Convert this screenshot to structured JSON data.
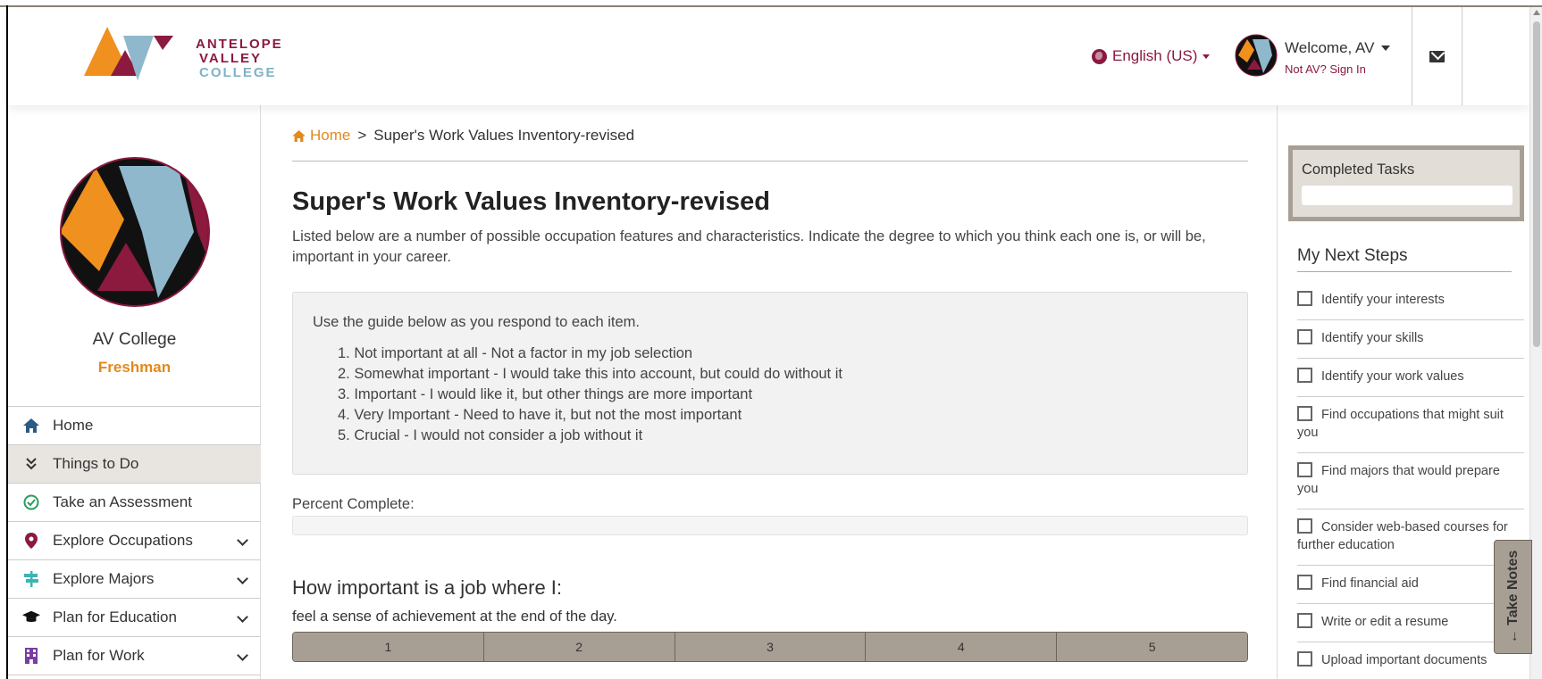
{
  "header": {
    "logo": {
      "line1": "ANTELOPE",
      "line2": "VALLEY",
      "line3": "COLLEGE"
    },
    "language": "English (US)",
    "welcome": "Welcome, AV",
    "sign_in": "Not AV? Sign In"
  },
  "profile": {
    "name": "AV College",
    "year": "Freshman"
  },
  "nav": {
    "items": [
      {
        "label": "Home",
        "icon": "home-icon"
      },
      {
        "label": "Things to Do",
        "icon": "double-chevron-down-icon"
      },
      {
        "label": "Take an Assessment",
        "icon": "check-circle-icon"
      },
      {
        "label": "Explore Occupations",
        "icon": "map-marker-icon"
      },
      {
        "label": "Explore Majors",
        "icon": "signpost-icon"
      },
      {
        "label": "Plan for Education",
        "icon": "graduation-cap-icon"
      },
      {
        "label": "Plan for Work",
        "icon": "building-icon"
      }
    ]
  },
  "breadcrumb": {
    "home": "Home",
    "separator": ">",
    "current": "Super's Work Values Inventory-revised"
  },
  "main": {
    "title": "Super's Work Values Inventory-revised",
    "intro": "Listed below are a number of possible occupation features and characteristics. Indicate the degree to which you think each one is, or will be, important in your career.",
    "guide_heading": "Use the guide below as you respond to each item.",
    "guide_items": [
      "1. Not important at all - Not a factor in my job selection",
      "2. Somewhat important - I would take this into account, but could do without it",
      "3. Important - I would like it, but other things are more important",
      "4. Very Important - Need to have it, but not the most important",
      "5. Crucial - I would not consider a job without it"
    ],
    "percent_label": "Percent Complete:",
    "percent_complete": 0,
    "question_title": "How important is a job where I:",
    "question": "feel a sense of achievement at the end of the day.",
    "ratings": [
      "1",
      "2",
      "3",
      "4",
      "5"
    ]
  },
  "rightbar": {
    "completed_title": "Completed Tasks",
    "steps_title": "My Next Steps",
    "steps": [
      "Identify your interests",
      "Identify your skills",
      "Identify your work values",
      "Find occupations that might suit you",
      "Find majors that would prepare you",
      "Consider web-based courses for further education",
      "Find financial aid",
      "Write or edit a resume",
      "Upload important documents"
    ],
    "take_notes": "Take Notes"
  },
  "colors": {
    "brand": "#8b1a3e",
    "accent": "#e08a1e",
    "taupe": "#a89f94",
    "blue": "#7fb2c7"
  }
}
